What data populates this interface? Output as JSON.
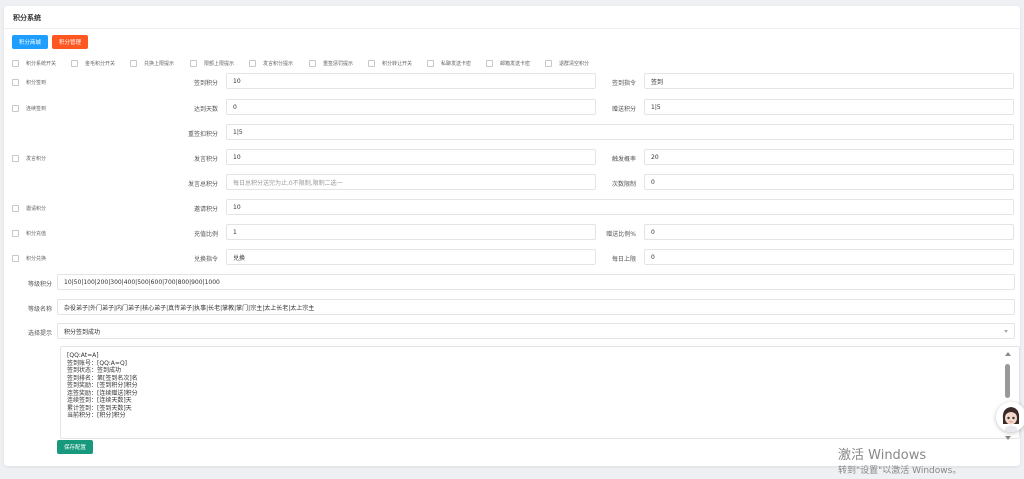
{
  "title": "积分系统",
  "buttons": {
    "mall": "积分商城",
    "manage": "积分管理",
    "save": "保存配置"
  },
  "colors": {
    "blue": "#1e9fff",
    "orange": "#ff5722",
    "green": "#16997c"
  },
  "switches": [
    "积分系统开关",
    "金毛积分开关",
    "兑换上限提示",
    "限额上限提示",
    "发言积分提示",
    "重签惩罚提示",
    "积分转让开关",
    "私聊发送卡密",
    "邮箱发送卡密",
    "退群清空积分"
  ],
  "sections": {
    "checkin": "积分签到",
    "streak": "连续签到",
    "speech": "发言积分",
    "invite": "邀请积分",
    "recharge": "积分充值",
    "exchange": "积分兑换"
  },
  "fields": {
    "checkin_points": {
      "label": "签到积分",
      "value": "10"
    },
    "checkin_command": {
      "label": "签到指令",
      "value": "签到"
    },
    "reach_days": {
      "label": "达到天数",
      "value": "0"
    },
    "bonus_points": {
      "label": "赠送积分",
      "value": "1|5"
    },
    "resign_penalty": {
      "label": "重签扣积分",
      "value": "1|5"
    },
    "speech_points": {
      "label": "发言积分",
      "value": "10"
    },
    "trigger_rate": {
      "label": "触发概率",
      "value": "20"
    },
    "speech_total": {
      "label": "发言总积分",
      "placeholder": "每日总积分送完为止,0不限制,限制二选一"
    },
    "count_limit": {
      "label": "次数限制",
      "value": "0"
    },
    "invite_points": {
      "label": "邀请积分",
      "value": "10"
    },
    "recharge_ratio": {
      "label": "充值比例",
      "value": "1"
    },
    "gift_ratio": {
      "label": "赠送比例%",
      "value": "0"
    },
    "exchange_command": {
      "label": "兑换指令",
      "value": "兑换"
    },
    "daily_limit": {
      "label": "每日上限",
      "value": "0"
    },
    "level_points": {
      "label": "等级积分",
      "value": "10|50|100|200|300|400|500|600|700|800|900|1000"
    },
    "level_names": {
      "label": "等级名称",
      "value": "杂役弟子|外门弟子|内门弟子|核心弟子|真传弟子|执事|长老|掌教|掌门|宗主|太上长老|太上宗主"
    },
    "prompt_select": {
      "label": "选择提示",
      "value": "积分签到成功"
    }
  },
  "template_lines": [
    "[QQ:At=A]",
    "签到账号：[QQ:A=Q]",
    "签到状态：签到成功",
    "签到排名：第[签到名次]名",
    "签到奖励：[签到积分]积分",
    "连签奖励：[连续赠送]积分",
    "连续签到：[连续天数]天",
    "累计签到：[签到天数]天",
    "当前积分：[积分]积分"
  ],
  "watermark": {
    "line1": "激活 Windows",
    "line2": "转到\"设置\"以激活 Windows。"
  }
}
